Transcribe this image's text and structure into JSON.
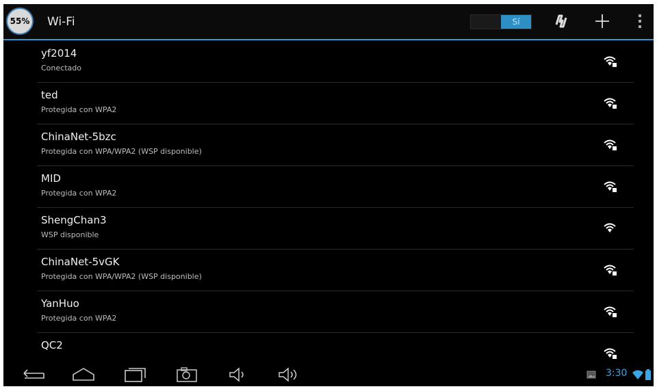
{
  "battery_badge": "55%",
  "header": {
    "title": "Wi-Fi",
    "toggle_label": "Sí"
  },
  "networks": [
    {
      "name": "yf2014",
      "status": "Conectado",
      "secured": true
    },
    {
      "name": "ted",
      "status": "Protegida con WPA2",
      "secured": true
    },
    {
      "name": "ChinaNet-5bzc",
      "status": "Protegida con WPA/WPA2 (WSP disponible)",
      "secured": true
    },
    {
      "name": "MID",
      "status": "Protegida con WPA2",
      "secured": true
    },
    {
      "name": "ShengChan3",
      "status": "WSP disponible",
      "secured": false
    },
    {
      "name": "ChinaNet-5vGK",
      "status": "Protegida con WPA/WPA2 (WSP disponible)",
      "secured": true
    },
    {
      "name": "YanHuo",
      "status": "Protegida con WPA2",
      "secured": true
    },
    {
      "name": "QC2",
      "status": "",
      "secured": true
    }
  ],
  "status_bar": {
    "time": "3:30"
  },
  "colors": {
    "accent": "#2d9bd6",
    "toggle_on": "#2e8fc4",
    "clock": "#3aa6e6"
  }
}
